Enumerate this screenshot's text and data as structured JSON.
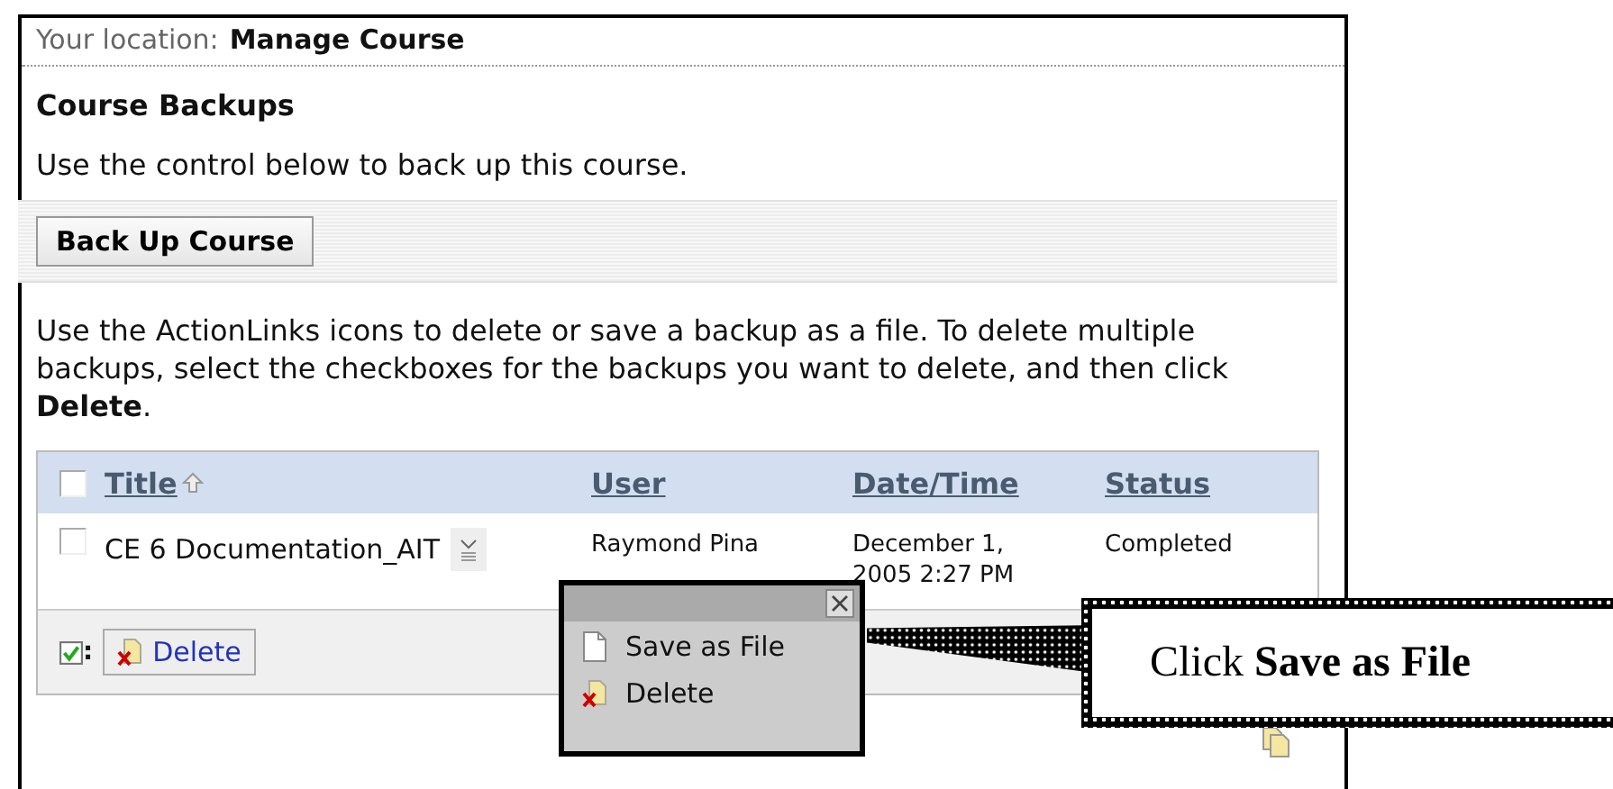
{
  "location": {
    "label": "Your location:",
    "page": "Manage Course"
  },
  "section_title": "Course Backups",
  "intro": "Use the control below to back up this course.",
  "backup_button": "Back Up Course",
  "instructions": "Use the ActionLinks icons to delete or save a backup as a file. To delete multiple backups, select the checkboxes for the backups you want to delete, and then click **Delete**.",
  "table": {
    "select_all_checked": false,
    "columns": [
      {
        "label": "Title",
        "sorted": true
      },
      {
        "label": "User",
        "sorted": false
      },
      {
        "label": "Date/Time",
        "sorted": false
      },
      {
        "label": "Status",
        "sorted": false
      }
    ],
    "rows": [
      {
        "checked": false,
        "title": "CE 6 Documentation_AIT",
        "user": "Raymond Pina",
        "date_time": "December 1, 2005 2:27 PM",
        "status": "Completed"
      }
    ],
    "footer": {
      "selected_label": ":",
      "delete_button": "Delete"
    }
  },
  "action_menu": {
    "items": [
      {
        "kind": "save",
        "label": "Save as File"
      },
      {
        "kind": "delete",
        "label": "Delete"
      }
    ]
  },
  "callout": "Click **Save as File**"
}
